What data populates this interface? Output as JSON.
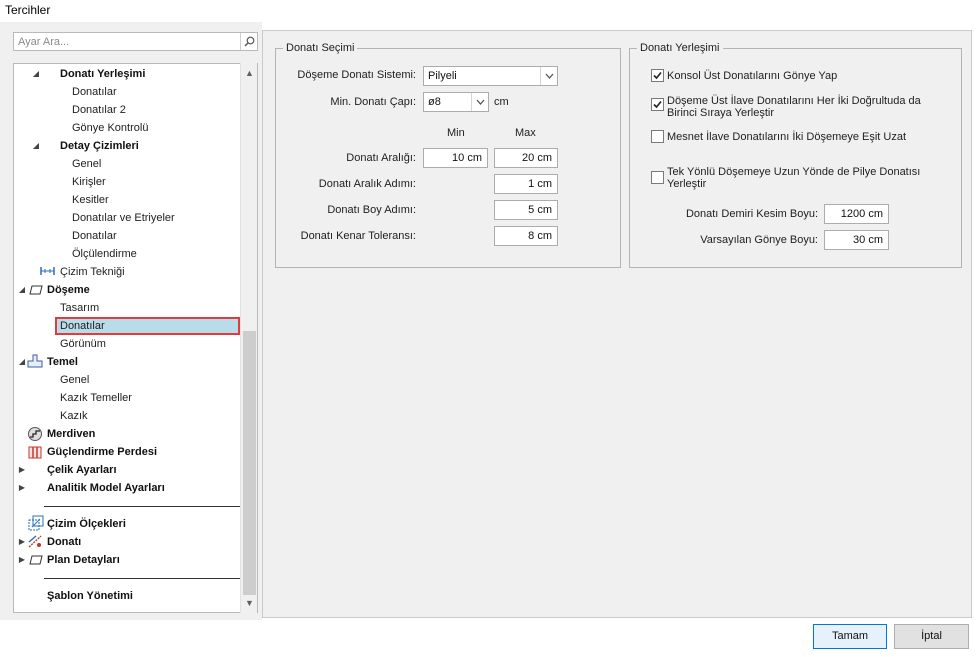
{
  "window": {
    "title": "Tercihler"
  },
  "search": {
    "placeholder": "Ayar Ara..."
  },
  "tree": {
    "donati_yerlesimi": "Donatı Yerleşimi",
    "donatilar": "Donatılar",
    "donatilar2": "Donatılar 2",
    "gonye_kontrolu": "Gönye Kontrolü",
    "detay_cizimleri": "Detay Çizimleri",
    "genel": "Genel",
    "kirisler": "Kirişler",
    "kesitler": "Kesitler",
    "donatilar_etriyeler": "Donatılar ve Etriyeler",
    "donatilar_detay": "Donatılar",
    "olculendirme": "Ölçülendirme",
    "cizim_teknigi": "Çizim Tekniği",
    "doseme": "Döşeme",
    "tasarim": "Tasarım",
    "doseme_donatilar": "Donatılar",
    "gorunum": "Görünüm",
    "temel": "Temel",
    "temel_genel": "Genel",
    "kazik_temeller": "Kazık Temeller",
    "kazik": "Kazık",
    "merdiven": "Merdiven",
    "guclendirme_perdesi": "Güçlendirme Perdesi",
    "celik_ayarlari": "Çelik Ayarları",
    "analitik_model": "Analitik Model Ayarları",
    "cizim_olcekleri": "Çizim Ölçekleri",
    "donati": "Donatı",
    "plan_detaylari": "Plan Detayları",
    "sablon_yonetimi": "Şablon Yönetimi"
  },
  "secim": {
    "legend": "Donatı Seçimi",
    "sistem_label": "Döşeme Donatı Sistemi:",
    "sistem_value": "Pilyeli",
    "cap_label": "Min. Donatı Çapı:",
    "cap_value": "ø8",
    "cap_unit": "cm",
    "min_header": "Min",
    "max_header": "Max",
    "araligi_label": "Donatı Aralığı:",
    "araligi_min": "10 cm",
    "araligi_max": "20 cm",
    "aralik_adimi_label": "Donatı Aralık Adımı:",
    "aralik_adimi": "1 cm",
    "boy_adimi_label": "Donatı Boy Adımı:",
    "boy_adimi": "5 cm",
    "kenar_label": "Donatı Kenar Toleransı:",
    "kenar": "8 cm"
  },
  "yerlesim": {
    "legend": "Donatı Yerleşimi",
    "cb1": "Konsol Üst Donatılarını Gönye Yap",
    "cb2_line1": "Döşeme Üst İlave Donatılarını Her İki Doğrultuda da",
    "cb2_line2": "Birinci Sıraya Yerleştir",
    "cb3": "Mesnet İlave Donatılarını İki Döşemeye Eşit Uzat",
    "cb4_line1": "Tek Yönlü Döşemeye Uzun Yönde de Pilye Donatısı",
    "cb4_line2": "Yerleştir",
    "kesim_label": "Donatı Demiri Kesim Boyu:",
    "kesim": "1200 cm",
    "gonye_label": "Varsayılan Gönye Boyu:",
    "gonye": "30 cm",
    "checked": [
      true,
      true,
      false,
      false
    ]
  },
  "buttons": {
    "ok": "Tamam",
    "cancel": "İptal"
  },
  "colors": {
    "selection_fill": "#b9dcea",
    "selection_border": "#e03c3c",
    "accent": "#0078d7"
  }
}
